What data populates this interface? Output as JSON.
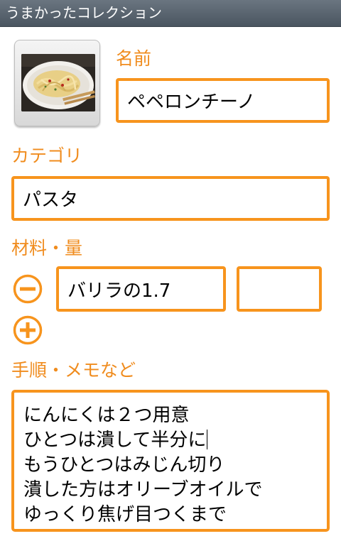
{
  "app": {
    "title": "うまかったコレクション"
  },
  "form": {
    "name_label": "名前",
    "name_value": "ペペロンチーノ",
    "category_label": "カテゴリ",
    "category_value": "パスタ",
    "ingredients_label": "材料・量",
    "ingredients": [
      {
        "item": "バリラの1.7",
        "amount": ""
      }
    ],
    "steps_label": "手順・メモなど",
    "steps_lines": [
      "にんにくは２つ用意",
      "ひとつは潰して半分に",
      "もうひとつはみじん切り",
      "潰した方はオリーブオイルで",
      "ゆっくり焦げ目つくまで"
    ]
  },
  "icons": {
    "photo": "dish-photo",
    "remove": "minus-circle-icon",
    "add": "plus-circle-icon"
  },
  "colors": {
    "accent": "#f7941d",
    "label": "#f08c1e",
    "titlebar": "#5a6570"
  }
}
